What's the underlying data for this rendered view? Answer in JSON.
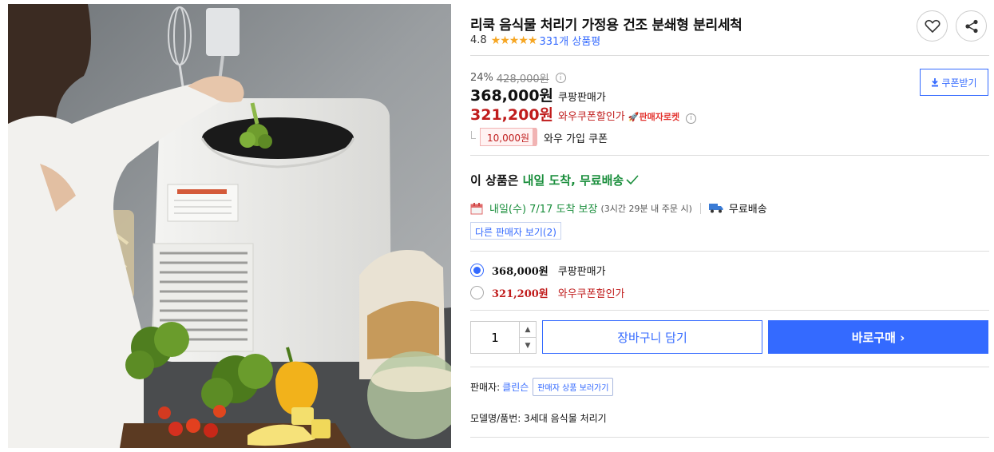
{
  "product": {
    "title": "리쿡 음식물 처리기 가정용 건조 분쇄형 분리세척",
    "rating": "4.8",
    "stars": "★★★★★",
    "review_count": "331개 상품평"
  },
  "pricing": {
    "discount_rate": "24%",
    "original_price": "428,000원",
    "sale_price": "368,000원",
    "sale_label": "쿠팡판매가",
    "coupon_price": "321,200원",
    "coupon_label": "와우쿠폰할인가",
    "rocket_badge": "판매자로켓",
    "coupon_amount": "10,000원",
    "coupon_desc": "와우 가입 쿠폰",
    "coupon_button": "쿠폰받기"
  },
  "delivery": {
    "headline_prefix": "이 상품은 ",
    "headline_highlight": "내일 도착, 무료배송",
    "arrival": "내일(수) 7/17 도착 보장",
    "arrival_note": "(3시간 29분 내 주문 시)",
    "shipping": "무료배송",
    "other_sellers": "다른 판매자 보기(2)"
  },
  "options": [
    {
      "price": "368,000원",
      "label": "쿠팡판매가",
      "selected": true
    },
    {
      "price": "321,200원",
      "label": "와우쿠폰할인가",
      "selected": false
    }
  ],
  "purchase": {
    "quantity": "1",
    "cart_label": "장바구니 담기",
    "buy_label": "바로구매 ›"
  },
  "seller": {
    "label": "판매자:",
    "name": "클린슨",
    "link": "판매자 상품 보러가기"
  },
  "model": {
    "text": "모델명/품번: 3세대 음식물 처리기"
  },
  "colors": {
    "accent": "#346aff",
    "red": "#c01c1c",
    "green": "#1a8e3c",
    "star": "#f6a623"
  },
  "icons": [
    "heart-icon",
    "share-icon",
    "info-icon",
    "download-icon",
    "check-icon",
    "calendar-icon",
    "truck-icon",
    "chevron-up-icon",
    "chevron-down-icon"
  ]
}
